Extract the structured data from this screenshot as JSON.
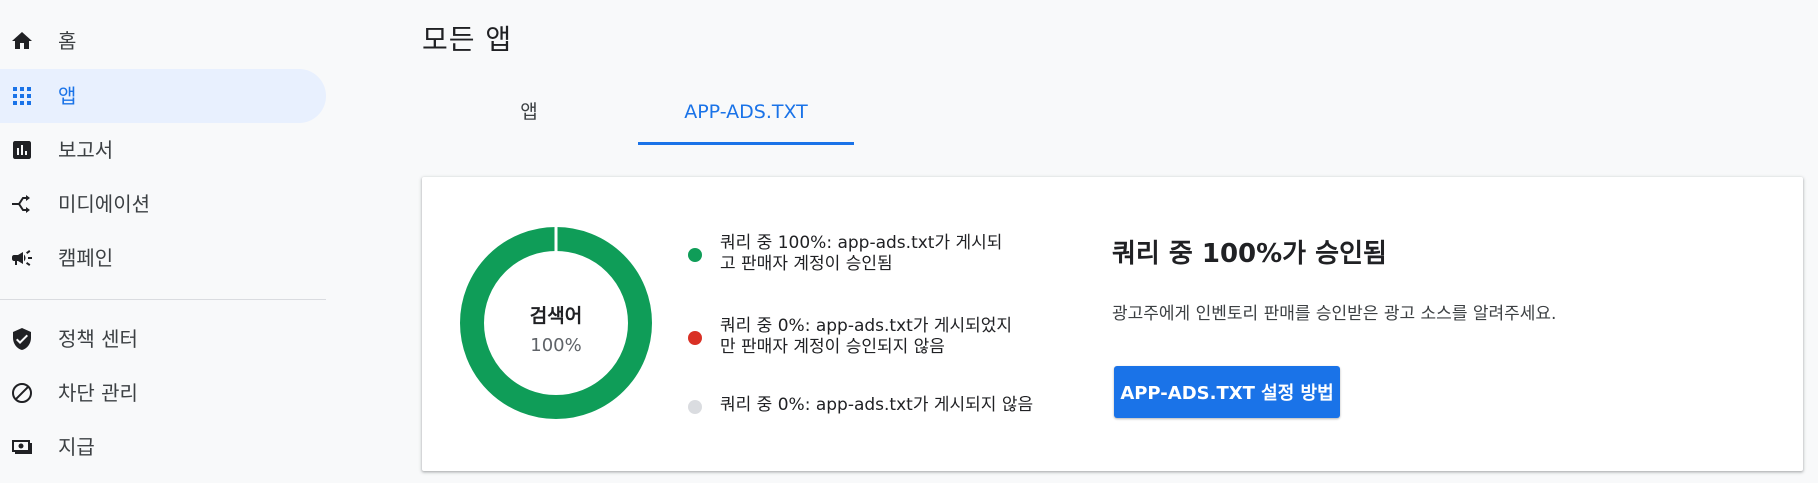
{
  "sidebar": {
    "items": [
      {
        "label": "홈",
        "icon": "home-icon"
      },
      {
        "label": "앱",
        "icon": "apps-grid-icon",
        "active": true
      },
      {
        "label": "보고서",
        "icon": "bar-chart-icon"
      },
      {
        "label": "미디에이션",
        "icon": "call-split-icon"
      },
      {
        "label": "캠페인",
        "icon": "megaphone-icon"
      },
      {
        "label": "정책 센터",
        "icon": "shield-check-icon"
      },
      {
        "label": "차단 관리",
        "icon": "block-icon"
      },
      {
        "label": "지급",
        "icon": "payments-icon"
      }
    ]
  },
  "header": {
    "title": "모든 앱"
  },
  "tabs": [
    {
      "label": "앱"
    },
    {
      "label": "APP-ADS.TXT",
      "active": true
    }
  ],
  "card": {
    "donut": {
      "label": "검색어",
      "value_text": "100%",
      "segments": [
        {
          "name": "approved",
          "percent": 100,
          "color": "#0f9d58"
        },
        {
          "name": "not_approved",
          "percent": 0,
          "color": "#d93025"
        },
        {
          "name": "not_posted",
          "percent": 0,
          "color": "#dadce0"
        }
      ]
    },
    "legend": [
      {
        "line1": "쿼리 중 100%: app-ads.txt가 게시되",
        "line2": "고 판매자 계정이 승인됨",
        "color": "#0f9d58"
      },
      {
        "line1": "쿼리 중 0%: app-ads.txt가 게시되었지",
        "line2": "만 판매자 계정이 승인되지 않음",
        "color": "#d93025"
      },
      {
        "line1": "쿼리 중 0%: app-ads.txt가 게시되지 않음",
        "line2": "",
        "color": "#dadce0"
      }
    ],
    "summary_title": "쿼리 중 100%가 승인됨",
    "summary_description": "광고주에게 인벤토리 판매를 승인받은 광고 소스를 알려주세요.",
    "button_label": "APP-ADS.TXT 설정 방법"
  },
  "colors": {
    "accent": "#1a73e8",
    "active_bg": "#e8f0fe",
    "approved": "#0f9d58",
    "not_approved": "#d93025",
    "not_posted": "#dadce0"
  }
}
